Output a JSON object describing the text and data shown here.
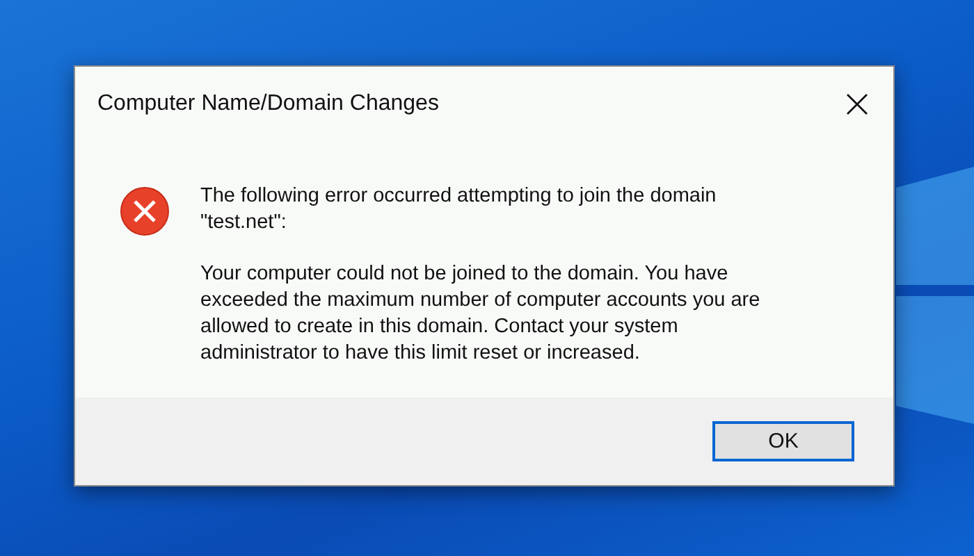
{
  "window": {
    "title": "Computer Name/Domain Changes"
  },
  "message": {
    "heading": "The following error occurred attempting to join the domain \"test.net\":",
    "detail": "Your computer could not be joined to the domain. You have exceeded the maximum number of computer accounts you are allowed to create in this domain. Contact your system administrator to have this limit reset or increased."
  },
  "buttons": [
    {
      "label": "OK",
      "selected": true
    }
  ]
}
